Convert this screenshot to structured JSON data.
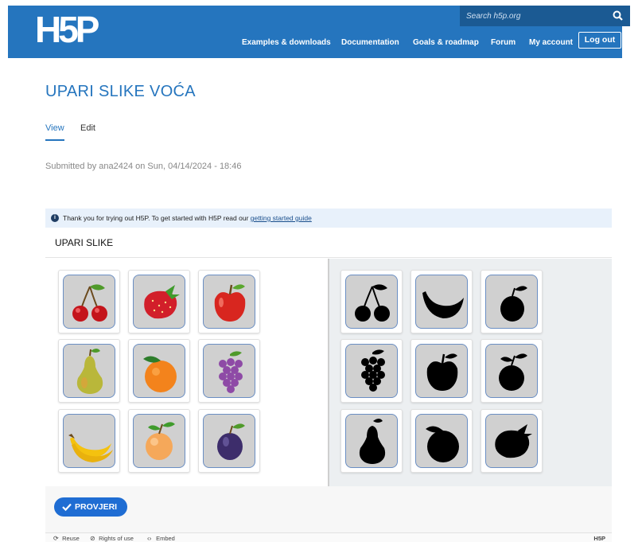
{
  "header": {
    "logo_text": "H5P",
    "search_placeholder": "Search h5p.org",
    "nav": [
      "Examples & downloads",
      "Documentation",
      "Goals & roadmap",
      "Forum",
      "My account"
    ],
    "logout_label": "Log out",
    "brand_color": "#2575be"
  },
  "page": {
    "title": "UPARI SLIKE VOĆA",
    "tabs": [
      "View",
      "Edit"
    ],
    "active_tab": "View",
    "submitted": "Submitted by ana2424 on Sun, 04/14/2024 - 18:46"
  },
  "h5p": {
    "notice_text": "Thank you for trying out H5P. To get started with H5P read our ",
    "notice_link": "getting started guide",
    "task_title": "UPARI SLIKE",
    "left_cards": [
      "cherry-image",
      "strawberry-image",
      "apple-image",
      "pear-image",
      "orange-image",
      "grapes-image",
      "banana-image",
      "apricot-image",
      "plum-image"
    ],
    "right_cards": [
      "cherry-silhouette",
      "banana-silhouette",
      "plum-silhouette",
      "grapes-silhouette",
      "apple-silhouette",
      "apricot-silhouette",
      "pear-silhouette",
      "orange-silhouette",
      "strawberry-silhouette"
    ],
    "check_label": "PROVJERI",
    "actions": {
      "reuse": "Reuse",
      "rights": "Rights of use",
      "embed": "Embed",
      "brand": "H5P"
    }
  }
}
